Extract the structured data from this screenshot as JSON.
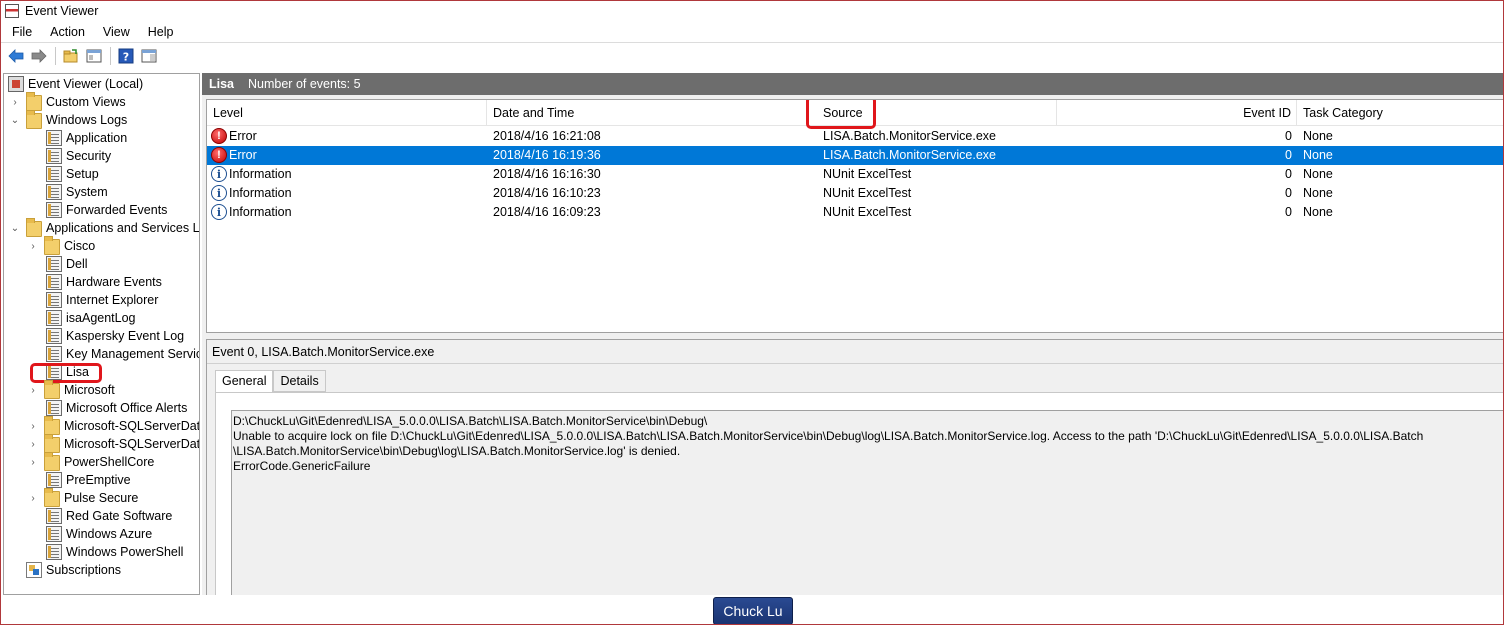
{
  "window": {
    "title": "Event Viewer"
  },
  "menu": [
    "File",
    "Action",
    "View",
    "Help"
  ],
  "toolbar": {
    "icons": [
      "back-arrow-icon",
      "forward-arrow-icon",
      "open-folder-icon",
      "show-hide-tree-icon",
      "help-icon",
      "properties-panel-icon"
    ]
  },
  "tree": {
    "items": [
      {
        "label": "Event Viewer (Local)",
        "icon": "root",
        "chevron": ""
      },
      {
        "label": "Custom Views",
        "icon": "folder",
        "chevron": ">"
      },
      {
        "label": "Windows Logs",
        "icon": "folder",
        "chevron": "v"
      },
      {
        "label": "Application",
        "icon": "log",
        "chevron": ""
      },
      {
        "label": "Security",
        "icon": "log",
        "chevron": ""
      },
      {
        "label": "Setup",
        "icon": "log",
        "chevron": ""
      },
      {
        "label": "System",
        "icon": "log",
        "chevron": ""
      },
      {
        "label": "Forwarded Events",
        "icon": "log",
        "chevron": ""
      },
      {
        "label": "Applications and Services Lo",
        "icon": "folder",
        "chevron": "v"
      },
      {
        "label": "Cisco",
        "icon": "folder",
        "chevron": ">"
      },
      {
        "label": "Dell",
        "icon": "log",
        "chevron": ""
      },
      {
        "label": "Hardware Events",
        "icon": "log",
        "chevron": ""
      },
      {
        "label": "Internet Explorer",
        "icon": "log",
        "chevron": ""
      },
      {
        "label": "isaAgentLog",
        "icon": "log",
        "chevron": ""
      },
      {
        "label": "Kaspersky Event Log",
        "icon": "log",
        "chevron": ""
      },
      {
        "label": "Key Management Service",
        "icon": "log",
        "chevron": ""
      },
      {
        "label": "Lisa",
        "icon": "log",
        "chevron": ""
      },
      {
        "label": "Microsoft",
        "icon": "folder",
        "chevron": ">"
      },
      {
        "label": "Microsoft Office Alerts",
        "icon": "log",
        "chevron": ""
      },
      {
        "label": "Microsoft-SQLServerData",
        "icon": "folder",
        "chevron": ">"
      },
      {
        "label": "Microsoft-SQLServerData",
        "icon": "folder",
        "chevron": ">"
      },
      {
        "label": "PowerShellCore",
        "icon": "folder",
        "chevron": ">"
      },
      {
        "label": "PreEmptive",
        "icon": "log",
        "chevron": ""
      },
      {
        "label": "Pulse Secure",
        "icon": "folder",
        "chevron": ">"
      },
      {
        "label": "Red Gate Software",
        "icon": "log",
        "chevron": ""
      },
      {
        "label": "Windows Azure",
        "icon": "log",
        "chevron": ""
      },
      {
        "label": "Windows PowerShell",
        "icon": "log",
        "chevron": ""
      },
      {
        "label": "Subscriptions",
        "icon": "sub",
        "chevron": ""
      }
    ]
  },
  "log": {
    "name": "Lisa",
    "count_text": "Number of events: 5"
  },
  "events": {
    "columns": [
      "Level",
      "Date and Time",
      "Source",
      "Event ID",
      "Task Category"
    ],
    "rows": [
      {
        "level": "Error",
        "level_icon": "error-icon",
        "datetime": "2018/4/16 16:21:08",
        "source": "LISA.Batch.MonitorService.exe",
        "event_id": "0",
        "category": "None",
        "selected": false
      },
      {
        "level": "Error",
        "level_icon": "error-icon",
        "datetime": "2018/4/16 16:19:36",
        "source": "LISA.Batch.MonitorService.exe",
        "event_id": "0",
        "category": "None",
        "selected": true
      },
      {
        "level": "Information",
        "level_icon": "info-icon",
        "datetime": "2018/4/16 16:16:30",
        "source": "NUnit ExcelTest",
        "event_id": "0",
        "category": "None",
        "selected": false
      },
      {
        "level": "Information",
        "level_icon": "info-icon",
        "datetime": "2018/4/16 16:10:23",
        "source": "NUnit ExcelTest",
        "event_id": "0",
        "category": "None",
        "selected": false
      },
      {
        "level": "Information",
        "level_icon": "info-icon",
        "datetime": "2018/4/16 16:09:23",
        "source": "NUnit ExcelTest",
        "event_id": "0",
        "category": "None",
        "selected": false
      }
    ]
  },
  "detail": {
    "title": "Event 0, LISA.Batch.MonitorService.exe",
    "tabs": [
      "General",
      "Details"
    ],
    "active_tab": "General",
    "description": "D:\\ChuckLu\\Git\\Edenred\\LISA_5.0.0.0\\LISA.Batch\\LISA.Batch.MonitorService\\bin\\Debug\\\nUnable to acquire lock on file D:\\ChuckLu\\Git\\Edenred\\LISA_5.0.0.0\\LISA.Batch\\LISA.Batch.MonitorService\\bin\\Debug\\log\\LISA.Batch.MonitorService.log. Access to the path 'D:\\ChuckLu\\Git\\Edenred\\LISA_5.0.0.0\\LISA.Batch\n\\LISA.Batch.MonitorService\\bin\\Debug\\log\\LISA.Batch.MonitorService.log' is denied.\nErrorCode.GenericFailure"
  },
  "badge": {
    "text": "Chuck Lu"
  },
  "colors": {
    "selection": "#0078d7",
    "header_bar": "#6d6d6d",
    "annotation_red": "#e0161b",
    "badge_blue": "#1a3472"
  }
}
